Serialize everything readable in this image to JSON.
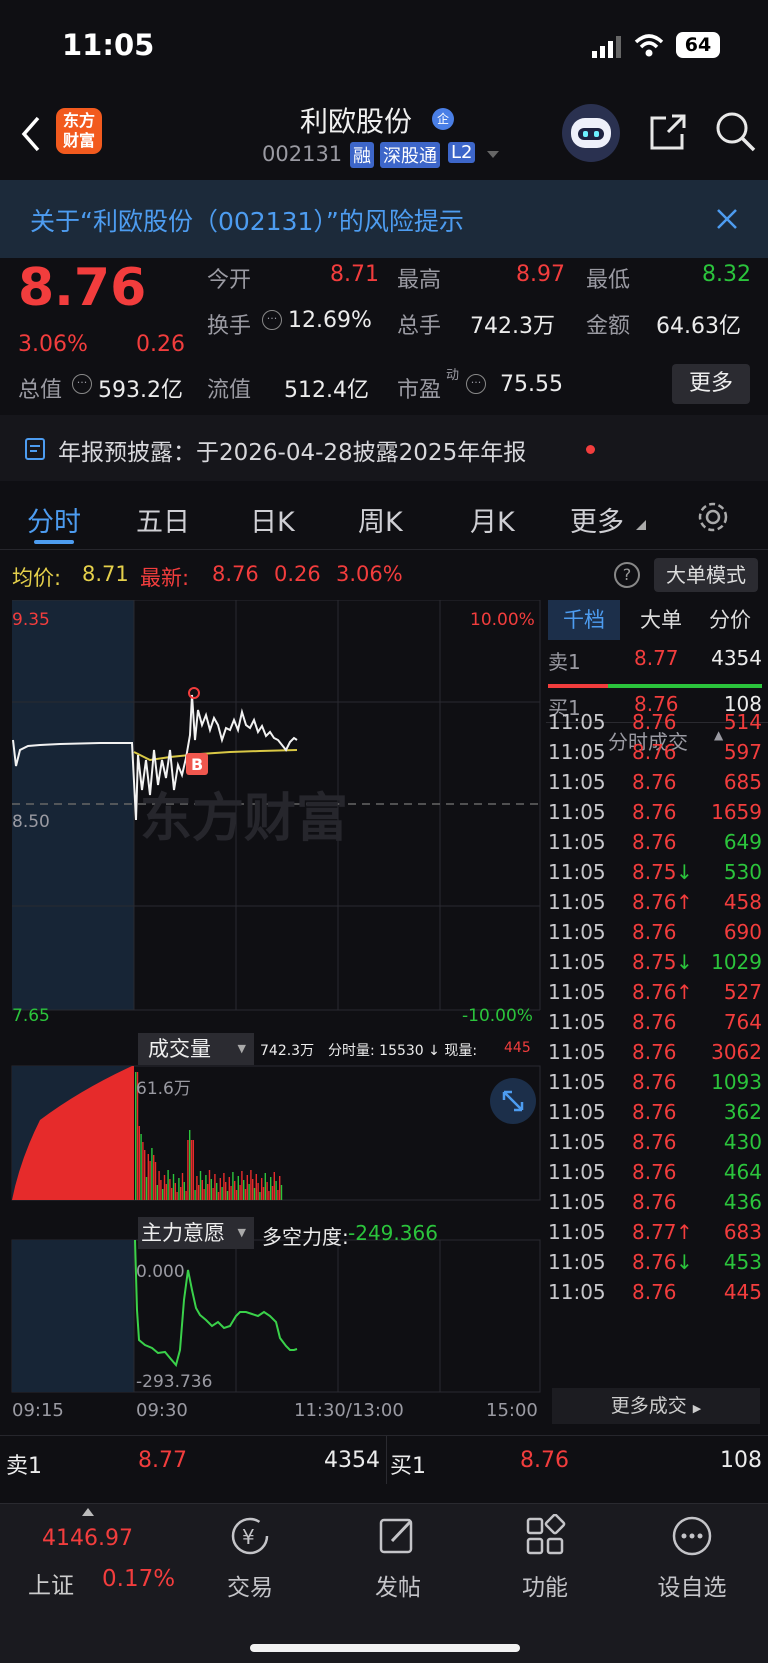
{
  "status": {
    "time": "11:05",
    "battery": "64"
  },
  "header": {
    "logo": "东方财富",
    "logo_line1": "东方",
    "logo_line2": "财富",
    "title": "利欧股份",
    "code": "002131",
    "badges": [
      "融",
      "深股通",
      "L2"
    ]
  },
  "notice": {
    "text": "关于“利欧股份（002131）”的风险提示"
  },
  "quote": {
    "price": "8.76",
    "change_pct": "3.06%",
    "change": "0.26",
    "open_label": "今开",
    "open": "8.71",
    "high_label": "最高",
    "high": "8.97",
    "low_label": "最低",
    "low": "8.32",
    "turnover_label": "换手",
    "turnover": "12.69%",
    "volume_label": "总手",
    "volume": "742.3万",
    "amount_label": "金额",
    "amount": "64.63亿",
    "mcap_label": "总值",
    "mcap": "593.2亿",
    "float_label": "流值",
    "float": "512.4亿",
    "pe_label": "市盈",
    "pe_sup": "动",
    "pe": "75.55",
    "more": "更多"
  },
  "annual": {
    "text": "年报预披露：于2026-04-28披露2025年年报"
  },
  "tabs": [
    "分时",
    "五日",
    "日K",
    "周K",
    "月K",
    "更多"
  ],
  "chart": {
    "avg_label": "均价:",
    "avg": "8.71",
    "latest_label": "最新:",
    "latest": "8.76",
    "latest_change": "0.26",
    "latest_pct": "3.06%",
    "big_mode": "大单模式",
    "y_top": "9.35",
    "y_mid": "8.50",
    "y_bot": "7.65",
    "pct_top": "10.00%",
    "pct_bot": "-10.00%",
    "watermark": "东方财富",
    "vol_selector": "成交量",
    "vol_info_total": "742.3万",
    "vol_info_label": "分时量: 15530 ↓ 现量:",
    "vol_info_now": "445",
    "vol_max": "61.6万",
    "force_selector": "主力意愿",
    "force_label": "多空力度:",
    "force_value": "-249.366",
    "force_top": "0.000",
    "force_bot": "-293.736",
    "times": [
      "09:15",
      "09:30",
      "11:30/13:00",
      "15:00"
    ]
  },
  "chart_data": {
    "type": "line",
    "title": "",
    "x": [
      "09:15",
      "09:30",
      "11:30/13:00",
      "15:00"
    ],
    "ylim": [
      7.65,
      9.35
    ],
    "prev_close": 8.5,
    "avg_price": 8.71,
    "last_price": 8.76
  },
  "panel": {
    "tabs": [
      "千档",
      "大单",
      "分价"
    ],
    "sell1": {
      "label": "卖1",
      "price": "8.77",
      "vol": "4354"
    },
    "buy1": {
      "label": "买1",
      "price": "8.76",
      "vol": "108"
    },
    "ticks_header": "分时成交",
    "more_ticks": "更多成交",
    "ticks": [
      {
        "t": "11:05",
        "p": "8.76",
        "a": "",
        "v": "514",
        "vc": "red"
      },
      {
        "t": "11:05",
        "p": "8.76",
        "a": "",
        "v": "597",
        "vc": "red"
      },
      {
        "t": "11:05",
        "p": "8.76",
        "a": "",
        "v": "685",
        "vc": "red"
      },
      {
        "t": "11:05",
        "p": "8.76",
        "a": "",
        "v": "1659",
        "vc": "red"
      },
      {
        "t": "11:05",
        "p": "8.76",
        "a": "",
        "v": "649",
        "vc": "green"
      },
      {
        "t": "11:05",
        "p": "8.75",
        "a": "↓",
        "v": "530",
        "vc": "green"
      },
      {
        "t": "11:05",
        "p": "8.76",
        "a": "↑",
        "v": "458",
        "vc": "red"
      },
      {
        "t": "11:05",
        "p": "8.76",
        "a": "",
        "v": "690",
        "vc": "red"
      },
      {
        "t": "11:05",
        "p": "8.75",
        "a": "↓",
        "v": "1029",
        "vc": "green"
      },
      {
        "t": "11:05",
        "p": "8.76",
        "a": "↑",
        "v": "527",
        "vc": "red"
      },
      {
        "t": "11:05",
        "p": "8.76",
        "a": "",
        "v": "764",
        "vc": "red"
      },
      {
        "t": "11:05",
        "p": "8.76",
        "a": "",
        "v": "3062",
        "vc": "red"
      },
      {
        "t": "11:05",
        "p": "8.76",
        "a": "",
        "v": "1093",
        "vc": "green"
      },
      {
        "t": "11:05",
        "p": "8.76",
        "a": "",
        "v": "362",
        "vc": "green"
      },
      {
        "t": "11:05",
        "p": "8.76",
        "a": "",
        "v": "430",
        "vc": "green"
      },
      {
        "t": "11:05",
        "p": "8.76",
        "a": "",
        "v": "464",
        "vc": "green"
      },
      {
        "t": "11:05",
        "p": "8.76",
        "a": "",
        "v": "436",
        "vc": "green"
      },
      {
        "t": "11:05",
        "p": "8.77",
        "a": "↑",
        "v": "683",
        "vc": "red"
      },
      {
        "t": "11:05",
        "p": "8.76",
        "a": "↓",
        "v": "453",
        "vc": "green"
      },
      {
        "t": "11:05",
        "p": "8.76",
        "a": "",
        "v": "445",
        "vc": "red"
      }
    ]
  },
  "orders": {
    "sell_label": "卖1",
    "sell_price": "8.77",
    "sell_vol": "4354",
    "buy_label": "买1",
    "buy_price": "8.76",
    "buy_vol": "108"
  },
  "nav": {
    "index_value": "4146.97",
    "index_name": "上证",
    "index_pct": "0.17%",
    "items": [
      "交易",
      "发帖",
      "功能",
      "设自选"
    ]
  }
}
